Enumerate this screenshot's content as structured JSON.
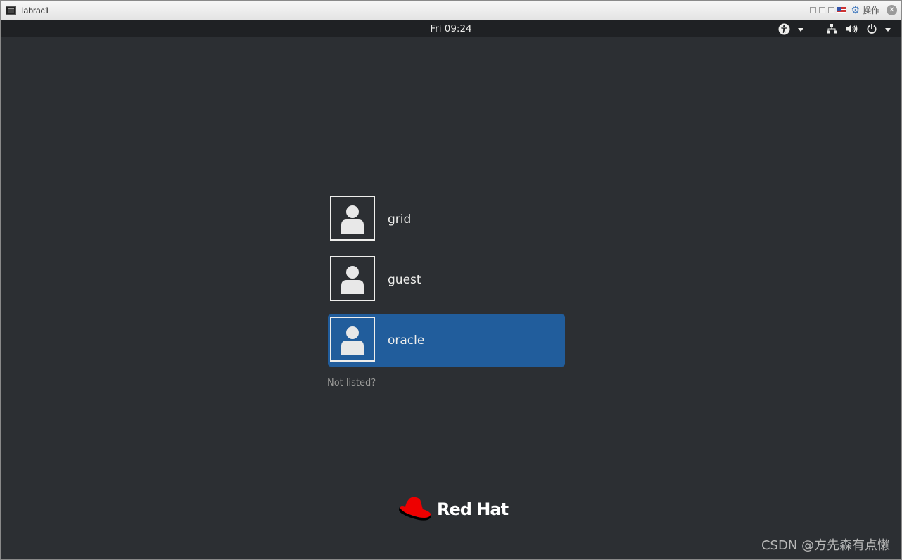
{
  "window": {
    "title": "labrac1",
    "actions_label": "操作"
  },
  "panel": {
    "clock": "Fri 09:24",
    "icons": [
      "accessibility-icon",
      "network-icon",
      "volume-icon",
      "power-icon"
    ]
  },
  "users": [
    {
      "name": "grid",
      "selected": false
    },
    {
      "name": "guest",
      "selected": false
    },
    {
      "name": "oracle",
      "selected": true
    }
  ],
  "not_listed_label": "Not listed?",
  "brand": {
    "name": "Red Hat",
    "color": "#ee0000"
  },
  "watermark": "CSDN @方先森有点懒",
  "colors": {
    "background": "#2c2f33",
    "selection": "#215d9c"
  }
}
